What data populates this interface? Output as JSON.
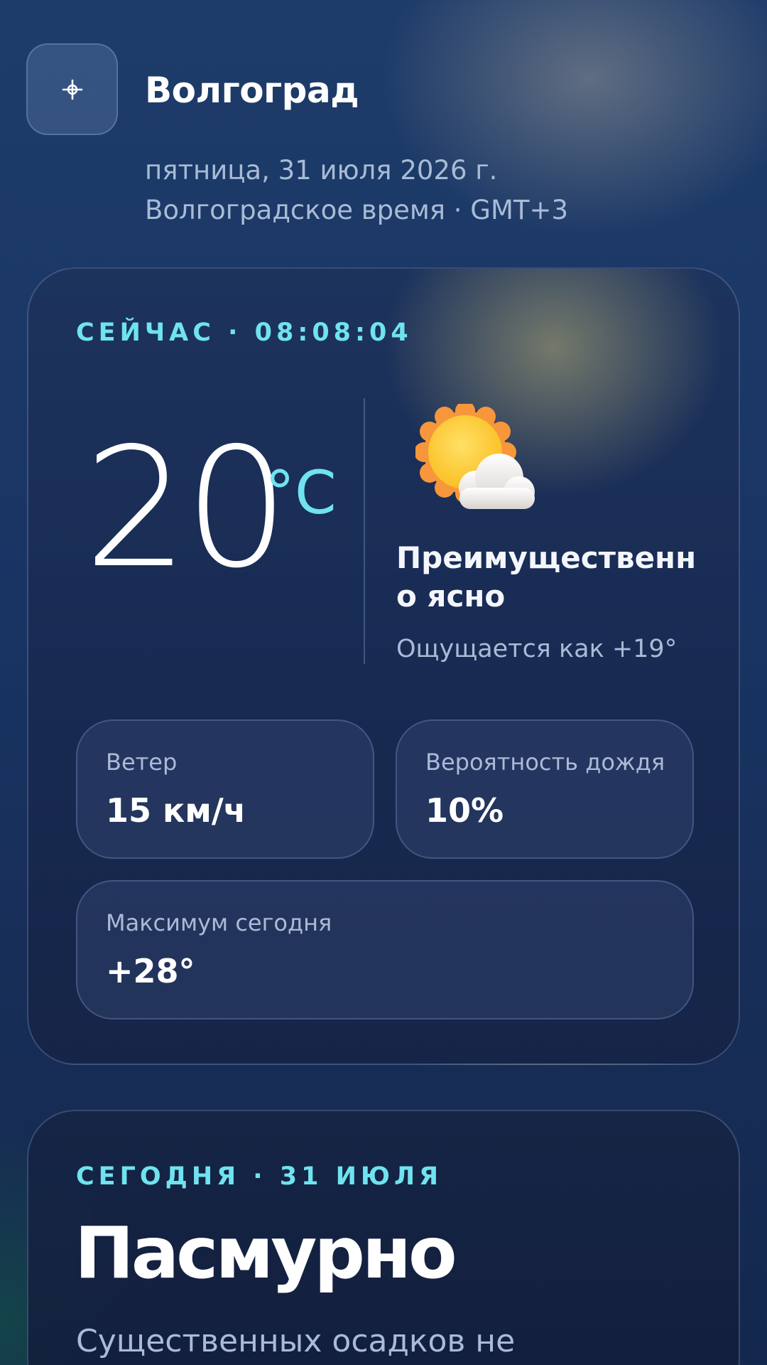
{
  "header": {
    "location_icon": "crosshair-icon",
    "city": "Волгоград",
    "date": "пятница, 31 июля 2026 г.",
    "timezone": "Волгоградское время · GMT+3"
  },
  "current": {
    "eyebrow": "СЕЙЧАС · 08:08:04",
    "temperature": "20",
    "unit": "°C",
    "weather_icon": "sun-behind-cloud-icon",
    "condition": "Преимущественно ясно",
    "feels_like": "Ощущается как +19°",
    "stats": {
      "wind": {
        "label": "Ветер",
        "value": "15 км/ч"
      },
      "rain": {
        "label": "Вероятность дождя",
        "value": "10%"
      },
      "max": {
        "label": "Максимум сегодня",
        "value": "+28°"
      }
    }
  },
  "today": {
    "eyebrow": "СЕГОДНЯ · 31 ИЮЛЯ",
    "title": "Пасмурно",
    "description": "Существенных осадков не"
  },
  "colors": {
    "accent": "#6fe3ef",
    "muted_text": "#a9bbd6",
    "background": "#1b3866"
  }
}
